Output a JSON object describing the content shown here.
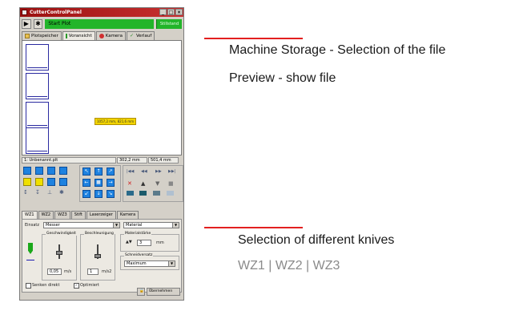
{
  "window": {
    "title": "CutterControlPanel",
    "buttons": [
      "_",
      "□",
      "×"
    ]
  },
  "toolbar": {
    "play_symbol": "▶",
    "settings_symbol": "✱",
    "start_plot_label": "Start Plot",
    "status_label": "Stillstand",
    "status_color": "#22b52a"
  },
  "tabs": [
    {
      "label": "Plotspeicher",
      "icon": "folder-icon"
    },
    {
      "label": "Voransicht",
      "icon": "bar-icon"
    },
    {
      "label": "Kamera",
      "icon": "camera-icon"
    },
    {
      "label": "Verlauf",
      "icon": "check-icon"
    }
  ],
  "preview": {
    "dimension_tag": "1057,2 mm, 821,6 mm"
  },
  "info_bar": {
    "filename": "1: Unbenannt.plt",
    "width": "302,2 mm",
    "height": "501,4 mm"
  },
  "move_controls": {
    "arrows": [
      "↖",
      "↑",
      "↗",
      "←",
      "■",
      "→",
      "↙",
      "↓",
      "↘"
    ],
    "media_buttons": [
      "|◀◀",
      "◀◀",
      "▶▶",
      "▶▶|"
    ],
    "action_symbols": [
      "✕",
      "▲",
      "▼",
      "■"
    ]
  },
  "tool_tabs": [
    "WZ1",
    "WZ2",
    "WZ3",
    "Stift",
    "Laserzeiger",
    "Kamera"
  ],
  "tool_panel": {
    "einsatz_label": "Einsatz",
    "einsatz_value": "Messer",
    "material_value": "Material",
    "speed_title": "Geschwindigkeit",
    "accel_title": "Beschleunigung",
    "material_strength_title": "Materialstärke",
    "material_strength_value": "3",
    "material_strength_unit": "mm",
    "blade_offset_title": "Schneidversatz",
    "blade_offset_value": "Maximum",
    "speed_value": "0,05",
    "speed_unit": "m/s",
    "accel_value": "1",
    "accel_unit": "m/s2",
    "lower_direct_label": "Senken direkt",
    "optimized_label": "Optimiert",
    "apply_button_label": "Übernehmen"
  },
  "annotations": {
    "top_line1": "Machine Storage - Selection of the file",
    "top_line2": "Preview - show file",
    "bottom_line1": "Selection of different knives",
    "bottom_line2": "WZ1 | WZ2 | WZ3",
    "line_color": "#e32020"
  }
}
